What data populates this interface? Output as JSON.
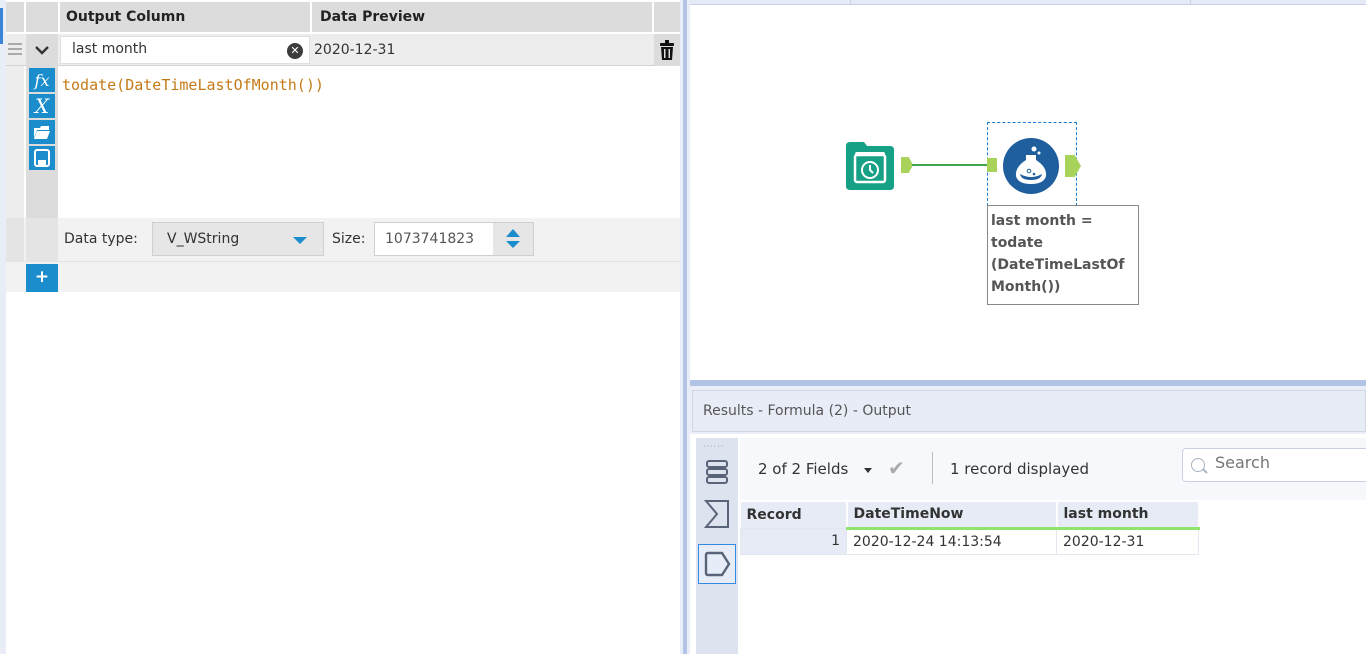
{
  "formula_panel": {
    "header": {
      "output_column": "Output Column",
      "data_preview": "Data Preview"
    },
    "expression_row": {
      "name": "last month",
      "preview": "2020-12-31",
      "expression": "todate(DateTimeLastOfMonth())"
    },
    "side_tools": [
      {
        "icon": "function-icon",
        "glyph": "fx"
      },
      {
        "icon": "variable-icon",
        "glyph": "X"
      },
      {
        "icon": "open-folder-icon",
        "glyph": "folder"
      },
      {
        "icon": "save-icon",
        "glyph": "floppy"
      }
    ],
    "data_type": {
      "label": "Data type:",
      "value": "V_WString"
    },
    "size": {
      "label": "Size:",
      "value": "1073741823"
    },
    "add_label": "+"
  },
  "canvas": {
    "annotation": [
      "last month =",
      "todate",
      "(DateTimeLastOf",
      "Month())"
    ],
    "colors": {
      "input_tool": "#16a085",
      "formula_tool": "#1f5f9e",
      "connection": "#3fa550",
      "anchor": "#a8d35a"
    }
  },
  "results": {
    "title": "Results - Formula (2) - Output",
    "fields_label": "2 of 2 Fields",
    "record_count": "1 record displayed",
    "search_placeholder": "Search",
    "columns": [
      "Record",
      "DateTimeNow",
      "last month"
    ],
    "rows": [
      {
        "record": "1",
        "DateTimeNow": "2020-12-24 14:13:54",
        "last_month": "2020-12-31"
      }
    ]
  }
}
